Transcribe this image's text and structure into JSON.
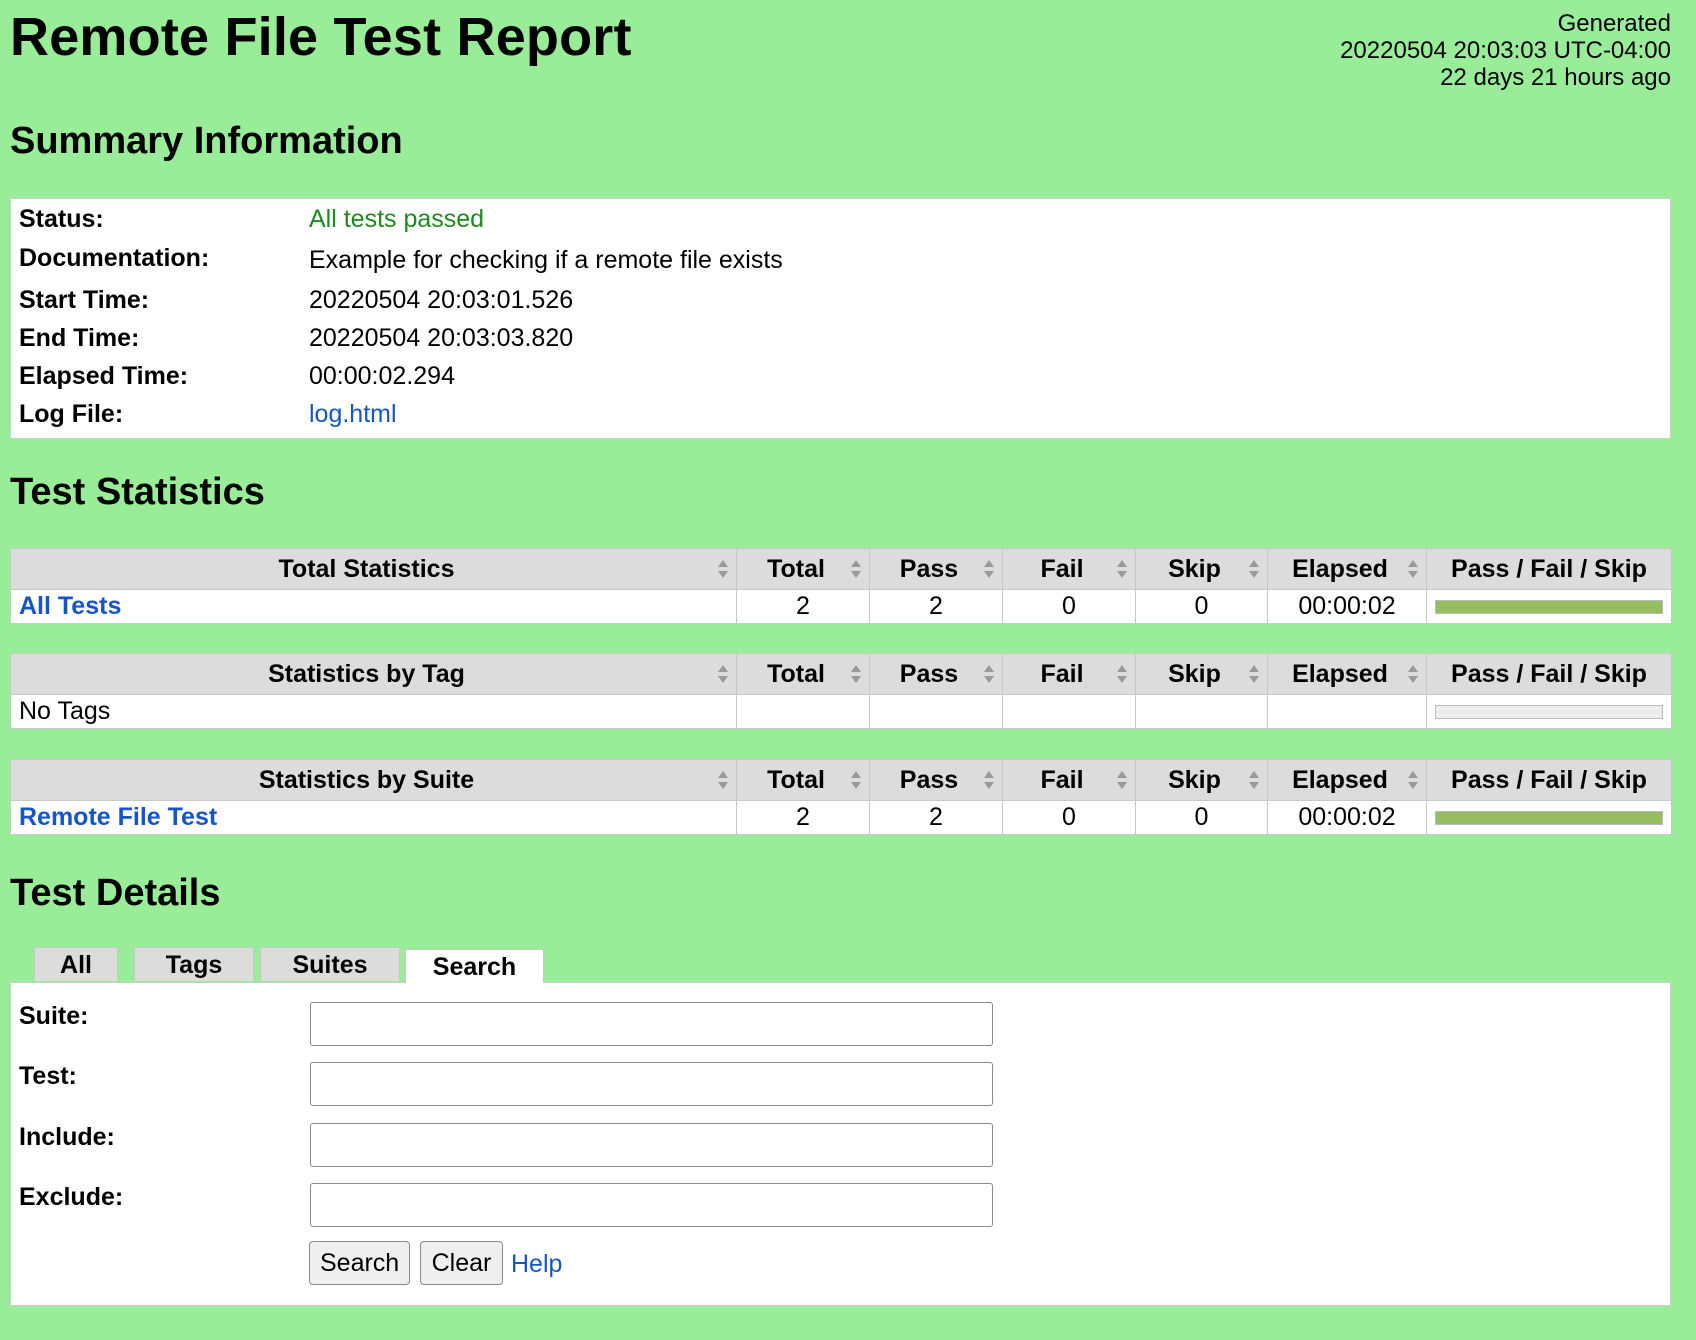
{
  "header": {
    "title": "Remote File Test Report",
    "generated_label": "Generated",
    "generated_time": "20220504 20:03:03 UTC-04:00",
    "generated_ago": "22 days 21 hours ago"
  },
  "summary": {
    "heading": "Summary Information",
    "rows": [
      {
        "label": "Status:",
        "value": "All tests passed"
      },
      {
        "label": "Documentation:",
        "value": "Example for checking if a remote file exists"
      },
      {
        "label": "Start Time:",
        "value": "20220504 20:03:01.526"
      },
      {
        "label": "End Time:",
        "value": "20220504 20:03:03.820"
      },
      {
        "label": "Elapsed Time:",
        "value": "00:00:02.294"
      },
      {
        "label": "Log File:",
        "value": "log.html"
      }
    ]
  },
  "statistics": {
    "heading": "Test Statistics",
    "columns": [
      "Total",
      "Pass",
      "Fail",
      "Skip",
      "Elapsed",
      "Pass / Fail / Skip"
    ],
    "tables": [
      {
        "title": "Total Statistics",
        "row": {
          "name": "All Tests",
          "total": "2",
          "pass": "2",
          "fail": "0",
          "skip": "0",
          "elapsed": "00:00:02",
          "pass_fraction": 1.0
        }
      },
      {
        "title": "Statistics by Tag",
        "row": {
          "name": "No Tags",
          "total": "",
          "pass": "",
          "fail": "",
          "skip": "",
          "elapsed": "",
          "pass_fraction": 0
        }
      },
      {
        "title": "Statistics by Suite",
        "row": {
          "name": "Remote File Test",
          "total": "2",
          "pass": "2",
          "fail": "0",
          "skip": "0",
          "elapsed": "00:00:02",
          "pass_fraction": 1.0
        }
      }
    ]
  },
  "details": {
    "heading": "Test Details",
    "tabs": [
      "All",
      "Tags",
      "Suites",
      "Search"
    ],
    "active_tab": "Search",
    "fields": [
      {
        "label": "Suite:",
        "value": ""
      },
      {
        "label": "Test:",
        "value": ""
      },
      {
        "label": "Include:",
        "value": ""
      },
      {
        "label": "Exclude:",
        "value": ""
      }
    ],
    "search_button": "Search",
    "clear_button": "Clear",
    "help_link": "Help"
  },
  "colors": {
    "background": "#99ed99",
    "pass": "#97bd61",
    "link": "#1555c7",
    "status_pass_text": "#1e8a1e"
  }
}
